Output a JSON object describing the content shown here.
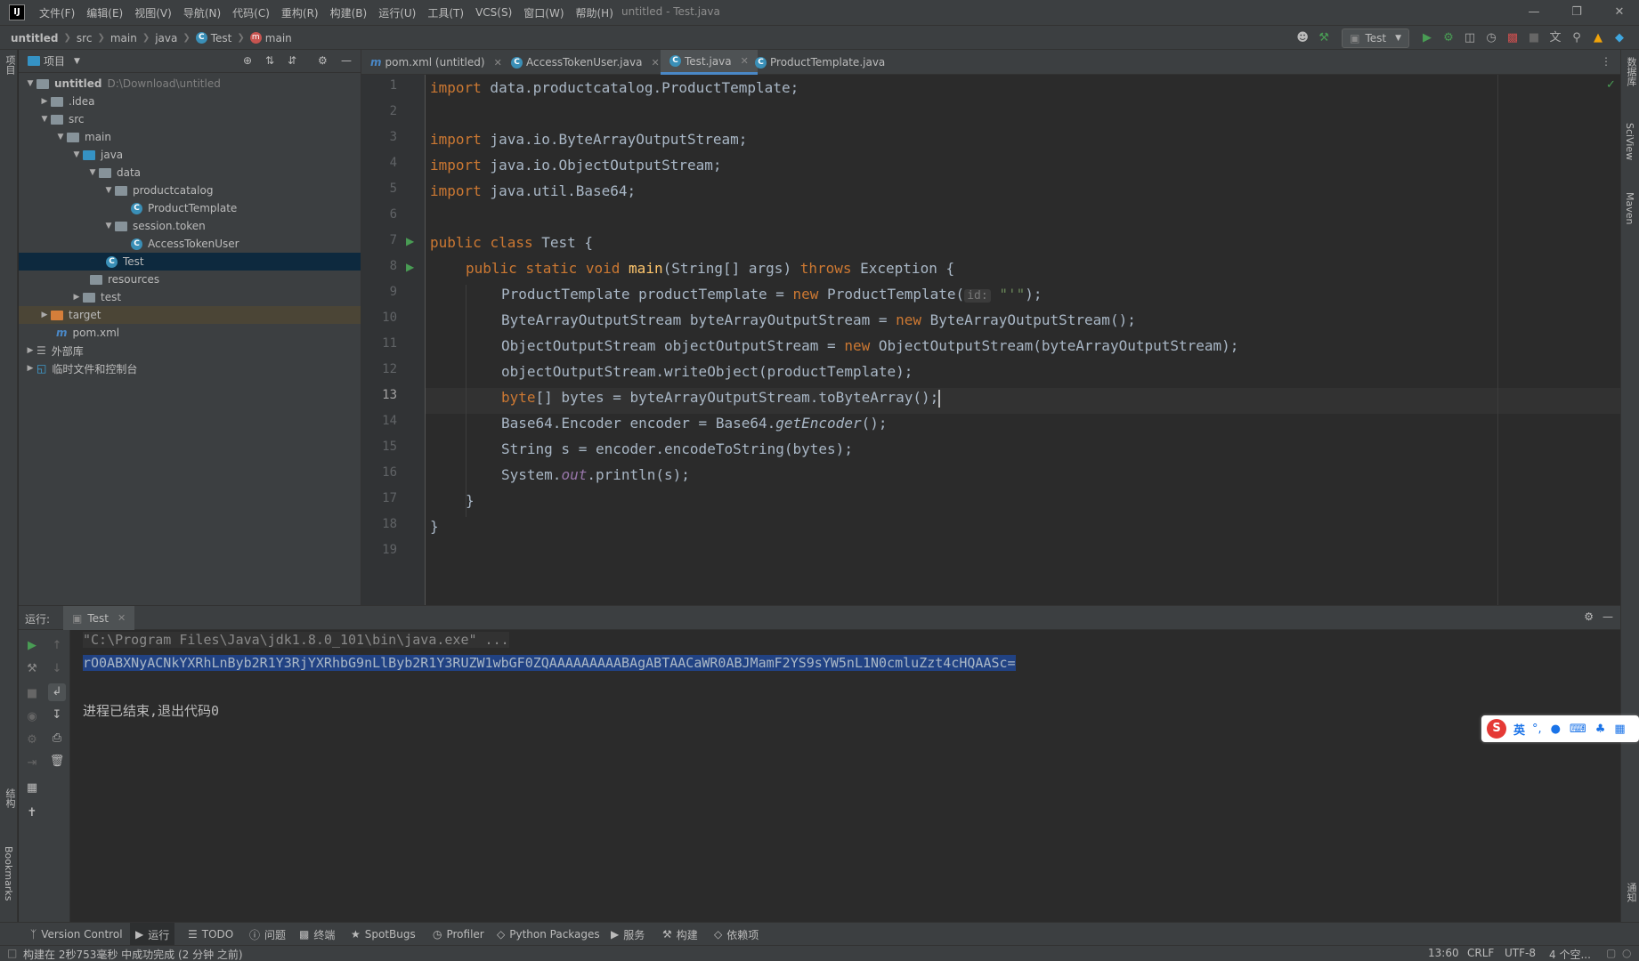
{
  "app": {
    "window_title": "untitled - Test.java",
    "logo_text": "IJ",
    "menu": [
      "文件(F)",
      "编辑(E)",
      "视图(V)",
      "导航(N)",
      "代码(C)",
      "重构(R)",
      "构建(B)",
      "运行(U)",
      "工具(T)",
      "VCS(S)",
      "窗口(W)",
      "帮助(H)"
    ]
  },
  "breadcrumb": [
    "untitled",
    "src",
    "main",
    "java",
    "Test",
    "main"
  ],
  "run_config": "Test",
  "left_stripe": {
    "project": "项目",
    "structure": "结构",
    "bookmarks": "Bookmarks"
  },
  "right_stripe": {
    "database": "数据库",
    "sciview": "SciView",
    "maven": "Maven",
    "notifications": "通知"
  },
  "project_panel": {
    "title": "项目",
    "tree": [
      {
        "label": "untitled",
        "path": "D:\\Download\\untitled"
      },
      {
        "label": ".idea"
      },
      {
        "label": "src"
      },
      {
        "label": "main"
      },
      {
        "label": "java"
      },
      {
        "label": "data"
      },
      {
        "label": "productcatalog"
      },
      {
        "label": "ProductTemplate"
      },
      {
        "label": "session.token"
      },
      {
        "label": "AccessTokenUser"
      },
      {
        "label": "Test"
      },
      {
        "label": "resources"
      },
      {
        "label": "test"
      },
      {
        "label": "target"
      },
      {
        "label": "pom.xml"
      },
      {
        "label": "外部库"
      },
      {
        "label": "临时文件和控制台"
      }
    ]
  },
  "editor_tabs": [
    {
      "label": "pom.xml (untitled)"
    },
    {
      "label": "AccessTokenUser.java"
    },
    {
      "label": "Test.java"
    },
    {
      "label": "ProductTemplate.java"
    }
  ],
  "editor": {
    "line_numbers": [
      "1",
      "2",
      "3",
      "4",
      "5",
      "6",
      "7",
      "8",
      "9",
      "10",
      "11",
      "12",
      "13",
      "14",
      "15",
      "16",
      "17",
      "18",
      "19"
    ],
    "current_line": "13"
  },
  "code": {
    "l1": [
      "import",
      " data.productcatalog.ProductTemplate;"
    ],
    "l3": [
      "import",
      " java.io.ByteArrayOutputStream;"
    ],
    "l4": [
      "import",
      " java.io.ObjectOutputStream;"
    ],
    "l5": [
      "import",
      " java.util.Base64;"
    ],
    "l7": [
      "public",
      " ",
      "class",
      " Test {"
    ],
    "l8": [
      "public",
      " ",
      "static",
      " ",
      "void",
      " ",
      "main",
      "(String[] args) ",
      "throws",
      " Exception {"
    ],
    "l9": [
      "ProductTemplate productTemplate = ",
      "new",
      " ProductTemplate(",
      "id:",
      " ",
      "\"'\"",
      ");"
    ],
    "l10": [
      "ByteArrayOutputStream byteArrayOutputStream = ",
      "new",
      " ByteArrayOutputStream();"
    ],
    "l11": [
      "ObjectOutputStream objectOutputStream = ",
      "new",
      " ObjectOutputStream(byteArrayOutputStream);"
    ],
    "l12": [
      "objectOutputStream.writeObject(productTemplate);"
    ],
    "l13": [
      "byte",
      "[] bytes = byteArrayOutputStream.toByteArray();"
    ],
    "l14": [
      "Base64.Encoder encoder = Base64.",
      "getEncoder",
      "();"
    ],
    "l15": [
      "String s = encoder.encodeToString(bytes);"
    ],
    "l16": [
      "System.",
      "out",
      ".println(s);"
    ],
    "l17": [
      "}"
    ],
    "l18": [
      "}"
    ]
  },
  "run_panel": {
    "label": "运行:",
    "tab": "Test",
    "console": [
      "\"C:\\Program Files\\Java\\jdk1.8.0_101\\bin\\java.exe\" ...",
      "rO0ABXNyACNkYXRhLnByb2R1Y3RjYXRhbG9nLlByb2R1Y3RUZW1wbGF0ZQAAAAAAAAABAgABTAACaWR0ABJMamF2YS9sYW5nL1N0cmluZzt4cHQAASc=",
      "进程已结束,退出代码0"
    ]
  },
  "ime": {
    "logo": "S",
    "lang": "英",
    "punct": "°,"
  },
  "bottom_tabs": [
    "Version Control",
    "运行",
    "TODO",
    "问题",
    "终端",
    "SpotBugs",
    "Profiler",
    "Python Packages",
    "服务",
    "构建",
    "依赖项"
  ],
  "status": {
    "message": "构建在 2秒753毫秒 中成功完成 (2 分钟 之前)",
    "position": "13:60",
    "line_sep": "CRLF",
    "encoding": "UTF-8",
    "indent": "4 个空..."
  },
  "colors": {
    "accent": "#4a88c7",
    "keyword": "#cc7832",
    "function": "#ffc66d",
    "run_green": "#499c54"
  }
}
